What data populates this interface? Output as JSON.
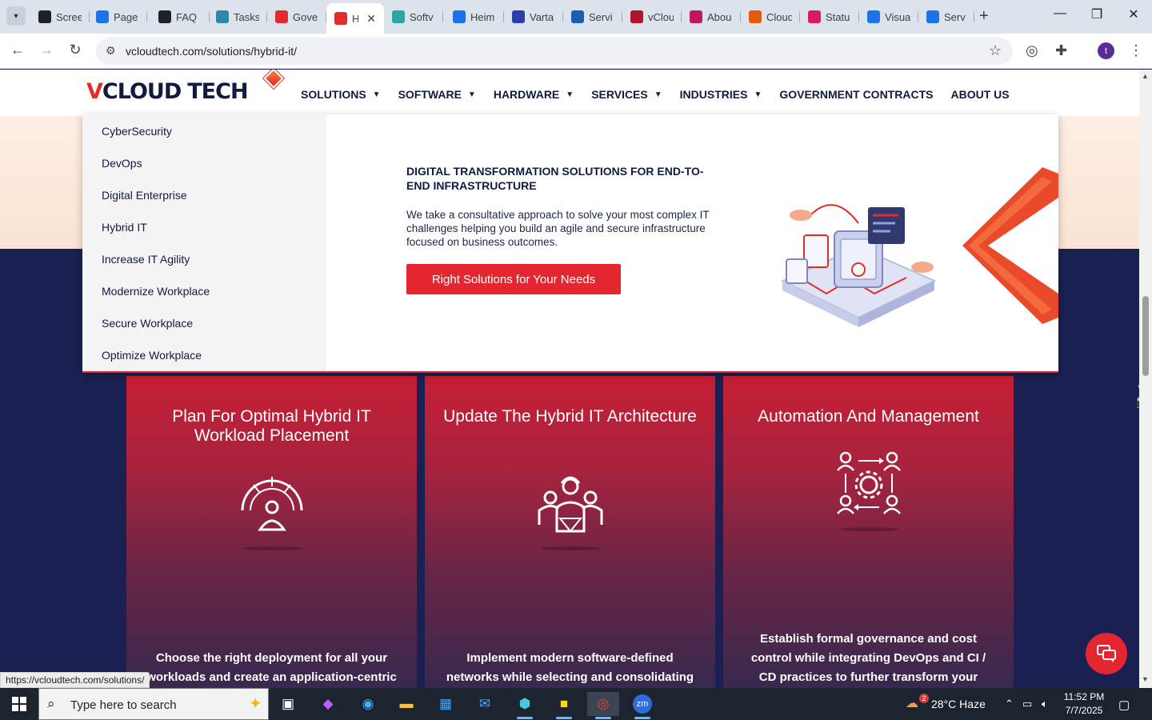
{
  "browser": {
    "tabs": [
      {
        "label": "Scree",
        "icon": "screenrec-icon",
        "color": "#202124"
      },
      {
        "label": "Page",
        "icon": "speed-icon",
        "color": "#1a73e8"
      },
      {
        "label": "FAQ",
        "icon": "target-icon",
        "color": "#202124"
      },
      {
        "label": "Tasks",
        "icon": "hex-icon",
        "color": "#2b8aab"
      },
      {
        "label": "Gove",
        "icon": "vcloud-diamond-icon",
        "color": "#e22b2b"
      },
      {
        "label": "H",
        "icon": "vcloud-diamond-icon",
        "color": "#e22b2b"
      },
      {
        "label": "Softv",
        "icon": "hex-icon",
        "color": "#2aa6a6"
      },
      {
        "label": "Heim",
        "icon": "scale-icon",
        "color": "#1a73e8"
      },
      {
        "label": "Varta",
        "icon": "x-icon",
        "color": "#2c3fa8"
      },
      {
        "label": "Servi",
        "icon": "check-icon",
        "color": "#1a5fb4"
      },
      {
        "label": "vClou",
        "icon": "v-icon",
        "color": "#b3122e"
      },
      {
        "label": "Abou",
        "icon": "dots-icon",
        "color": "#c2185b"
      },
      {
        "label": "Cloud",
        "icon": "slash-icon",
        "color": "#e8590c"
      },
      {
        "label": "Statu",
        "icon": "pen-icon",
        "color": "#d81b60"
      },
      {
        "label": "Visua",
        "icon": "pulse-icon",
        "color": "#1a73e8"
      },
      {
        "label": "Serv",
        "icon": "doc-icon",
        "color": "#1a73e8"
      }
    ],
    "active_tab_index": 5,
    "url": "vcloudtech.com/solutions/hybrid-it/",
    "profile_initial": "t",
    "status_url": "https://vcloudtech.com/solutions/"
  },
  "site": {
    "logo": {
      "v": "V",
      "cloud": "CLOUD",
      "tech": "TECH"
    },
    "nav": [
      {
        "label": "SOLUTIONS",
        "dropdown": true
      },
      {
        "label": "SOFTWARE",
        "dropdown": true
      },
      {
        "label": "HARDWARE",
        "dropdown": true
      },
      {
        "label": "SERVICES",
        "dropdown": true
      },
      {
        "label": "INDUSTRIES",
        "dropdown": true
      },
      {
        "label": "GOVERNMENT CONTRACTS",
        "dropdown": false
      },
      {
        "label": "ABOUT US",
        "dropdown": false
      }
    ],
    "mega_menu": {
      "items": [
        "CyberSecurity",
        "DevOps",
        "Digital Enterprise",
        "Hybrid IT",
        "Increase IT Agility",
        "Modernize Workplace",
        "Secure Workplace",
        "Optimize Workplace"
      ],
      "title": "DIGITAL TRANSFORMATION SOLUTIONS FOR END-TO-END INFRASTRUCTURE",
      "description": "We take a consultative approach to solve your most complex IT challenges helping you build an agile and secure infrastructure focused on business outcomes.",
      "button": "Right Solutions for Your Needs"
    },
    "cards": [
      {
        "title": "Plan For Optimal Hybrid IT Workload Placement",
        "icon": "gauge-person-icon",
        "text": "Choose the right deployment for all your workloads and create an application-centric cloud roadmap, including application rationalization strategies and data architectures based on your needs."
      },
      {
        "title": "Update The Hybrid IT Architecture",
        "icon": "engineers-icon",
        "text": "Implement modern software-defined networks while selecting and consolidating cloud infrastructures, modernizing traditional data centers, and upgrading and extending security."
      },
      {
        "title": "Automation And Management",
        "icon": "automation-gear-icon",
        "text": "Establish formal governance and cost control while integrating DevOps and CI / CD practices to further transform your application through agile sprint-based projects to faster the Hybrid IT performance."
      }
    ],
    "colors": {
      "brand_red": "#e3262f",
      "navy": "#111a3f",
      "page_bg": "#1a2152"
    }
  },
  "taskbar": {
    "search_placeholder": "Type here to search",
    "weather": "28°C  Haze",
    "weather_badge": "2",
    "time": "11:52 PM",
    "date": "7/7/2025"
  }
}
